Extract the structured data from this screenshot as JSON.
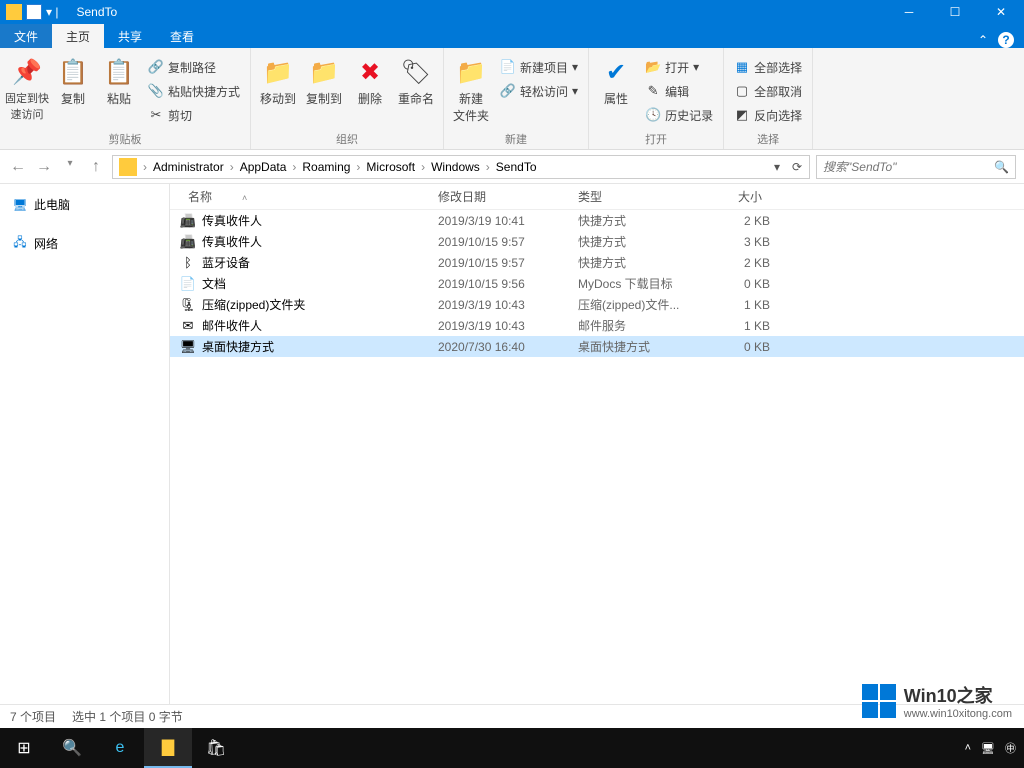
{
  "title": "SendTo",
  "tabs": {
    "file": "文件",
    "home": "主页",
    "share": "共享",
    "view": "查看"
  },
  "ribbon": {
    "clipboard": {
      "label": "剪贴板",
      "pin": "固定到快\n速访问",
      "copy": "复制",
      "paste": "粘贴",
      "copypath": "复制路径",
      "pastelink": "粘贴快捷方式",
      "cut": "剪切"
    },
    "organize": {
      "label": "组织",
      "moveto": "移动到",
      "copyto": "复制到",
      "delete": "删除",
      "rename": "重命名"
    },
    "new": {
      "label": "新建",
      "newfolder": "新建\n文件夹",
      "newitem": "新建项目",
      "easyaccess": "轻松访问"
    },
    "open": {
      "label": "打开",
      "properties": "属性",
      "open": "打开",
      "edit": "编辑",
      "history": "历史记录"
    },
    "select": {
      "label": "选择",
      "selectall": "全部选择",
      "selectnone": "全部取消",
      "invert": "反向选择"
    }
  },
  "breadcrumb": [
    "Administrator",
    "AppData",
    "Roaming",
    "Microsoft",
    "Windows",
    "SendTo"
  ],
  "search_placeholder": "搜索\"SendTo\"",
  "navpane": {
    "thispc": "此电脑",
    "network": "网络"
  },
  "columns": {
    "name": "名称",
    "date": "修改日期",
    "type": "类型",
    "size": "大小"
  },
  "files": [
    {
      "icon": "📠",
      "name": "传真收件人",
      "date": "2019/3/19 10:41",
      "type": "快捷方式",
      "size": "2 KB",
      "sel": false
    },
    {
      "icon": "📠",
      "name": "传真收件人",
      "date": "2019/10/15 9:57",
      "type": "快捷方式",
      "size": "3 KB",
      "sel": false
    },
    {
      "icon": "ᛒ",
      "name": "蓝牙设备",
      "date": "2019/10/15 9:57",
      "type": "快捷方式",
      "size": "2 KB",
      "sel": false
    },
    {
      "icon": "📄",
      "name": "文档",
      "date": "2019/10/15 9:56",
      "type": "MyDocs 下载目标",
      "size": "0 KB",
      "sel": false
    },
    {
      "icon": "🗜",
      "name": "压缩(zipped)文件夹",
      "date": "2019/3/19 10:43",
      "type": "压缩(zipped)文件...",
      "size": "1 KB",
      "sel": false
    },
    {
      "icon": "✉",
      "name": "邮件收件人",
      "date": "2019/3/19 10:43",
      "type": "邮件服务",
      "size": "1 KB",
      "sel": false
    },
    {
      "icon": "🖥",
      "name": "桌面快捷方式",
      "date": "2020/7/30 16:40",
      "type": "桌面快捷方式",
      "size": "0 KB",
      "sel": true
    }
  ],
  "status": {
    "count": "7 个项目",
    "selection": "选中 1 个项目  0 字节"
  },
  "taskbar_time": "",
  "watermark": {
    "brand": "Win10之家",
    "url": "www.win10xitong.com"
  }
}
